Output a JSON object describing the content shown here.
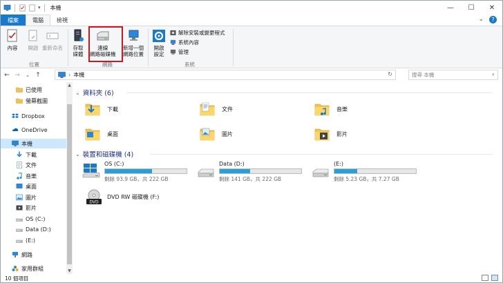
{
  "titlebar": {
    "title": "本機",
    "min": "—",
    "max": "☐",
    "close": "✕"
  },
  "tabs": {
    "file": "檔案",
    "computer": "電腦",
    "view": "檢視"
  },
  "ribbon": {
    "properties": "內容",
    "open": "開啟",
    "rename": "重新命名",
    "location_group": "位置",
    "access_media": "存取\n媒體",
    "map_drive": "連線\n網路磁碟機",
    "add_network_location": "新增一個\n網路位置",
    "network_group": "網路",
    "open_settings": "開啟\n設定",
    "uninstall": "解除安裝或變更程式",
    "system_properties": "系統內容",
    "manage": "管理",
    "system_group": "系統"
  },
  "address": {
    "path": "本機",
    "search_placeholder": "搜尋 本機"
  },
  "nav": {
    "items": [
      {
        "label": "已使用",
        "icon": "folder-icon"
      },
      {
        "label": "螢幕截圖",
        "icon": "folder-icon"
      },
      {
        "label": "Dropbox",
        "icon": "dropbox-icon"
      },
      {
        "label": "OneDrive",
        "icon": "onedrive-icon"
      },
      {
        "label": "本機",
        "icon": "computer-icon"
      },
      {
        "label": "下載",
        "icon": "download-icon"
      },
      {
        "label": "文件",
        "icon": "document-icon"
      },
      {
        "label": "音樂",
        "icon": "music-icon"
      },
      {
        "label": "桌面",
        "icon": "desktop-icon"
      },
      {
        "label": "圖片",
        "icon": "pictures-icon"
      },
      {
        "label": "影片",
        "icon": "video-icon"
      },
      {
        "label": "OS (C:)",
        "icon": "drive-icon"
      },
      {
        "label": "Data (D:)",
        "icon": "drive-icon"
      },
      {
        "label": "(E:)",
        "icon": "drive-icon"
      },
      {
        "label": "網路",
        "icon": "network-icon"
      },
      {
        "label": "家用群組",
        "icon": "homegroup-icon"
      }
    ]
  },
  "content": {
    "folders_header": "資料夾 (6)",
    "folders": [
      {
        "label": "下載",
        "icon": "download-folder-icon"
      },
      {
        "label": "文件",
        "icon": "documents-folder-icon"
      },
      {
        "label": "音樂",
        "icon": "music-folder-icon"
      },
      {
        "label": "桌面",
        "icon": "desktop-folder-icon"
      },
      {
        "label": "圖片",
        "icon": "pictures-folder-icon"
      },
      {
        "label": "影片",
        "icon": "videos-folder-icon"
      }
    ],
    "devices_header": "裝置和磁碟機 (4)",
    "drives": [
      {
        "name": "OS (C:)",
        "info": "剩餘 93.9 GB，共 222 GB",
        "used_fraction": 0.58
      },
      {
        "name": "Data (D:)",
        "info": "剩餘 141 GB，共 222 GB",
        "used_fraction": 0.37
      },
      {
        "name": "(E:)",
        "info": "剩餘 5.23 GB，共 7.27 GB",
        "used_fraction": 0.28
      }
    ],
    "dvd": {
      "name": "DVD RW 磁碟機 (F:)"
    }
  },
  "status": {
    "count": "10 個項目"
  },
  "colors": {
    "accent": "#1979ca",
    "highlight": "#d2141e",
    "progress": "#26a0da",
    "selection": "#cce8ff"
  }
}
